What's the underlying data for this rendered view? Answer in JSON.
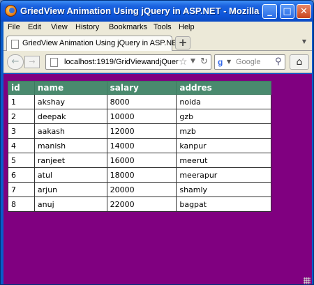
{
  "window": {
    "title": "GriedView Animation Using jQuery in ASP.NET - Mozilla Fi...",
    "minimize_label": "_",
    "maximize_label": "□",
    "close_label": "✕"
  },
  "menu": {
    "items": [
      {
        "label": "File"
      },
      {
        "label": "Edit"
      },
      {
        "label": "View"
      },
      {
        "label": "History"
      },
      {
        "label": "Bookmarks"
      },
      {
        "label": "Tools"
      },
      {
        "label": "Help"
      }
    ]
  },
  "tabs": [
    {
      "label": "GriedView Animation Using jQuery in ASP.NET"
    }
  ],
  "new_tab_label": "+",
  "nav": {
    "url": "localhost:1919/GridViewandjQuer",
    "search_placeholder": "Google"
  },
  "grid": {
    "headers": [
      "id",
      "name",
      "salary",
      "addres"
    ],
    "rows": [
      [
        "1",
        "akshay",
        "8000",
        "noida"
      ],
      [
        "2",
        "deepak",
        "10000",
        "gzb"
      ],
      [
        "3",
        "aakash",
        "12000",
        "mzb"
      ],
      [
        "4",
        "manish",
        "14000",
        "kanpur"
      ],
      [
        "5",
        "ranjeet",
        "16000",
        "meerut"
      ],
      [
        "6",
        "atul",
        "18000",
        "meerapur"
      ],
      [
        "7",
        "arjun",
        "20000",
        "shamly"
      ],
      [
        "8",
        "anuj",
        "22000",
        "bagpat"
      ]
    ]
  },
  "colors": {
    "page_background": "#800080",
    "grid_header": "#4a8a6e",
    "titlebar": "#0e55d8"
  },
  "icons": {
    "app": "firefox-icon",
    "tab": "page-icon",
    "back": "back-arrow-icon",
    "forward": "forward-arrow-icon",
    "bookmark": "star-icon",
    "reload": "reload-icon",
    "search_engine": "google-icon",
    "search": "magnifier-icon",
    "home": "home-icon"
  }
}
